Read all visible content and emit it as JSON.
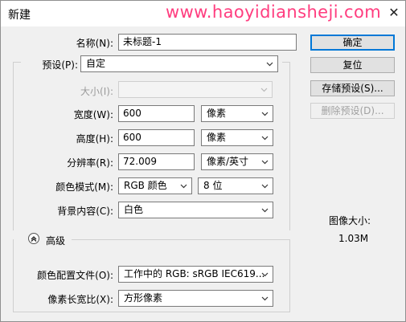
{
  "window": {
    "title": "新建",
    "watermark": "www.haoyidiansheji.com",
    "close_glyph": "✕"
  },
  "form": {
    "name": {
      "label": "名称(N):",
      "value": "未标题-1"
    },
    "preset": {
      "label": "预设(P):",
      "value": "自定"
    },
    "size": {
      "label": "大小(I):",
      "value": ""
    },
    "width": {
      "label": "宽度(W):",
      "value": "600",
      "unit": "像素"
    },
    "height": {
      "label": "高度(H):",
      "value": "600",
      "unit": "像素"
    },
    "resolution": {
      "label": "分辨率(R):",
      "value": "72.009",
      "unit": "像素/英寸"
    },
    "color_mode": {
      "label": "颜色模式(M):",
      "mode": "RGB 颜色",
      "depth": "8 位"
    },
    "background": {
      "label": "背景内容(C):",
      "value": "白色"
    },
    "advanced": {
      "label": "高级"
    },
    "color_profile": {
      "label": "颜色配置文件(O):",
      "value": "工作中的 RGB: sRGB IEC619..."
    },
    "pixel_aspect": {
      "label": "像素长宽比(X):",
      "value": "方形像素"
    }
  },
  "buttons": {
    "ok": "确定",
    "reset": "复位",
    "save_preset": "存储预设(S)...",
    "delete_preset": "删除预设(D)..."
  },
  "image_size": {
    "label": "图像大小:",
    "value": "1.03M"
  },
  "colors": {
    "accent": "#0078d7",
    "watermark": "#ff3d7f"
  }
}
